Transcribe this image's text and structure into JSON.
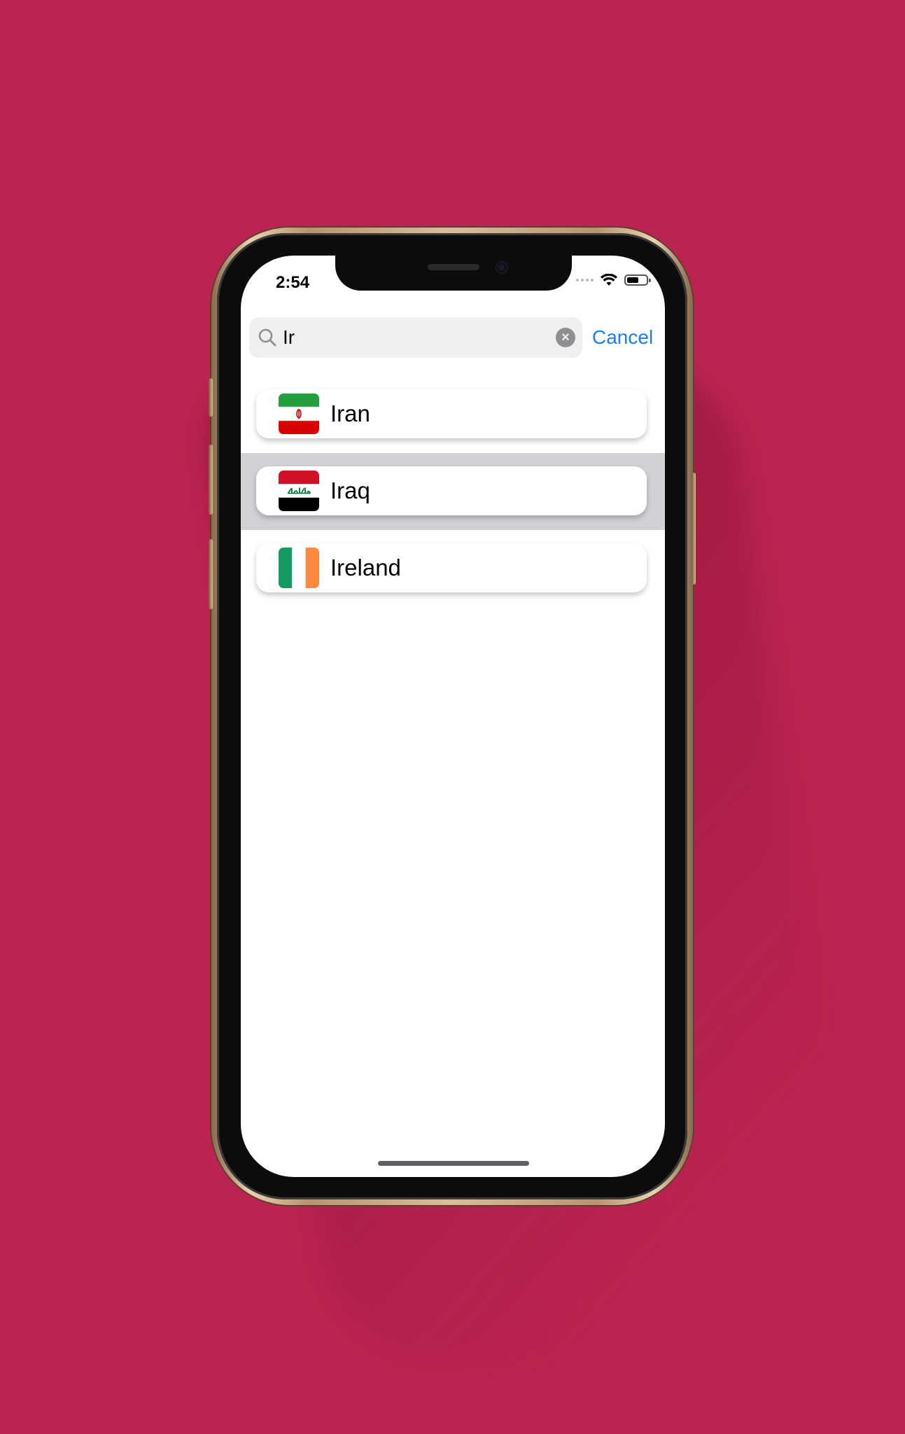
{
  "status_bar": {
    "time": "2:54",
    "battery_level": 0.6
  },
  "search": {
    "query": "Ir",
    "cancel_label": "Cancel"
  },
  "results": [
    {
      "name": "Iran",
      "flag": "iran-flag",
      "selected": false
    },
    {
      "name": "Iraq",
      "flag": "iraq-flag",
      "selected": true
    },
    {
      "name": "Ireland",
      "flag": "ireland-flag",
      "selected": false
    }
  ],
  "colors": {
    "background": "#bb2350",
    "accent": "#1a7ef0",
    "selected_row": "#d1d1d6",
    "search_field": "#efeff0"
  }
}
